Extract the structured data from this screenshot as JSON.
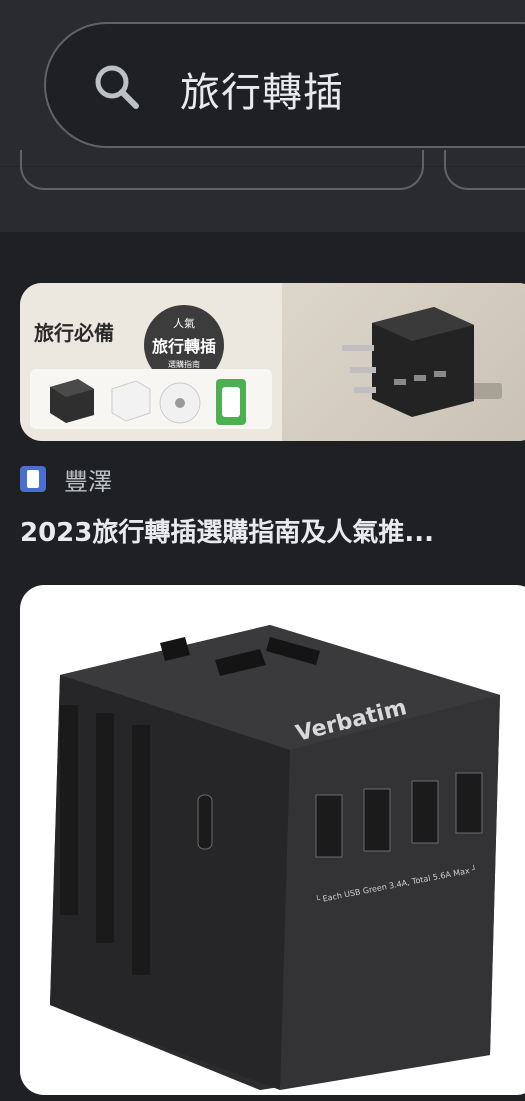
{
  "search": {
    "icon": "search-icon",
    "query": "旅行轉插"
  },
  "results": [
    {
      "image": {
        "caption_left": "旅行必備",
        "badge_line1": "人氣",
        "badge_line2": "旅行轉插",
        "badge_line3": "選購指南"
      },
      "source_icon": "feng-tak-favicon",
      "source": "豐澤",
      "title": "2023旅行轉插選購指南及人氣推..."
    },
    {
      "image": {
        "brand": "Verbatim",
        "port_label": "└ Each USB Green 3.4A, Total 5.6A Max ┘"
      }
    }
  ],
  "colors": {
    "background": "#1f2023",
    "header": "#2a2b2f",
    "outline": "#5f6368",
    "favicon": "#4a6fd1"
  }
}
